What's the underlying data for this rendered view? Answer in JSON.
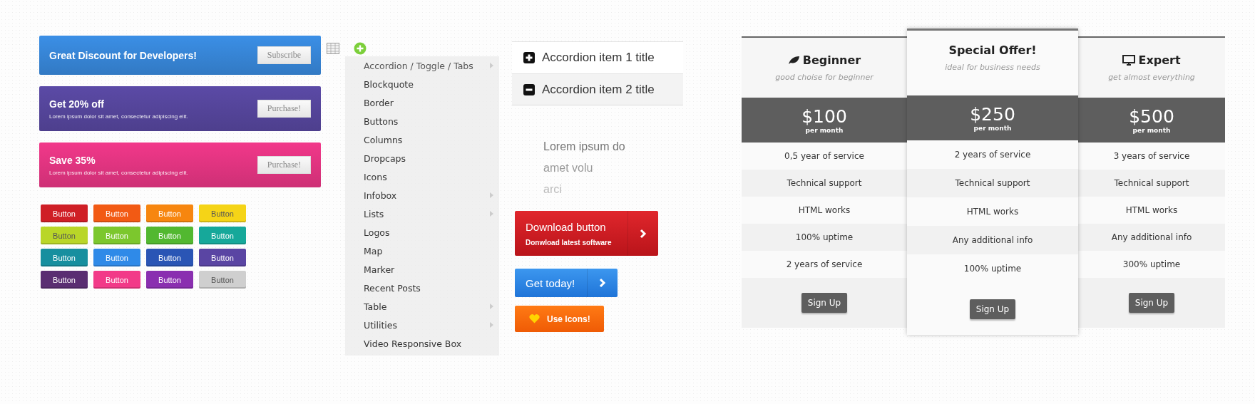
{
  "banners": [
    {
      "title": "Great Discount for Developers!",
      "button": "Subscribe",
      "color": "#3b8fe6"
    },
    {
      "title": "Get 20% off",
      "text": "Lorem ipsum dolor sit amet, consectetur adipiscing elit.",
      "button": "Purchase!",
      "color": "#5b4aa6"
    },
    {
      "title": "Save 35%",
      "text": "Lorem ipsum dolor sit amet, consectetur adipiscing elit.",
      "button": "Purchase!",
      "color": "#f2388a"
    }
  ],
  "color_buttons": [
    {
      "label": "Button",
      "color": "#cf1f26"
    },
    {
      "label": "Button",
      "color": "#f25a14"
    },
    {
      "label": "Button",
      "color": "#f7860f"
    },
    {
      "label": "Button",
      "color": "#f5d417"
    },
    {
      "label": "Button",
      "color": "#b9d628"
    },
    {
      "label": "Button",
      "color": "#7cc72d"
    },
    {
      "label": "Button",
      "color": "#52b830"
    },
    {
      "label": "Button",
      "color": "#16a89a"
    },
    {
      "label": "Button",
      "color": "#178f9f"
    },
    {
      "label": "Button",
      "color": "#2f8ae8"
    },
    {
      "label": "Button",
      "color": "#2a55b5"
    },
    {
      "label": "Button",
      "color": "#5a45a3"
    },
    {
      "label": "Button",
      "color": "#5a2e72"
    },
    {
      "label": "Button",
      "color": "#f23a88"
    },
    {
      "label": "Button",
      "color": "#8a2fb0"
    },
    {
      "label": "Button",
      "color": "#cfcfcf"
    }
  ],
  "shortcode_menu": {
    "items": [
      {
        "label": "Accordion / Toggle / Tabs",
        "has_submenu": true
      },
      {
        "label": "Blockquote",
        "has_submenu": false
      },
      {
        "label": "Border",
        "has_submenu": false
      },
      {
        "label": "Buttons",
        "has_submenu": false
      },
      {
        "label": "Columns",
        "has_submenu": false
      },
      {
        "label": "Dropcaps",
        "has_submenu": false
      },
      {
        "label": "Icons",
        "has_submenu": false
      },
      {
        "label": "Infobox",
        "has_submenu": true
      },
      {
        "label": "Lists",
        "has_submenu": true
      },
      {
        "label": "Logos",
        "has_submenu": false
      },
      {
        "label": "Map",
        "has_submenu": false
      },
      {
        "label": "Marker",
        "has_submenu": false
      },
      {
        "label": "Recent Posts",
        "has_submenu": false
      },
      {
        "label": "Table",
        "has_submenu": true
      },
      {
        "label": "Utilities",
        "has_submenu": true
      },
      {
        "label": "Video Responsive Box",
        "has_submenu": false
      }
    ]
  },
  "accordion": [
    {
      "title": "Accordion item 1 title",
      "expanded": false
    },
    {
      "title": "Accordion item 2 title",
      "expanded": true,
      "body_lines": [
        "Lorem ipsum do",
        "amet volu",
        "arci"
      ]
    }
  ],
  "action_buttons": [
    {
      "kind": "download",
      "label": "Download button",
      "sublabel": "Donwload latest software"
    },
    {
      "kind": "arrow",
      "label": "Get today!"
    },
    {
      "kind": "icon",
      "label": "Use Icons!"
    }
  ],
  "pricing": [
    {
      "featured": false,
      "name": "Beginner",
      "subtitle": "good choise for beginner",
      "price": "$100",
      "period": "per month",
      "features": [
        "0,5 year of service",
        "Technical support",
        "HTML works",
        "100% uptime",
        "2 years of service"
      ],
      "button": "Sign Up"
    },
    {
      "featured": true,
      "name": "Special Offer!",
      "subtitle": "ideal for business needs",
      "price": "$250",
      "period": "per month",
      "features": [
        "2 years of service",
        "Technical support",
        "HTML works",
        "Any additional info",
        "100% uptime"
      ],
      "button": "Sign Up"
    },
    {
      "featured": false,
      "name": "Expert",
      "subtitle": "get almost everything",
      "price": "$500",
      "period": "per month",
      "features": [
        "3 years of service",
        "Technical support",
        "HTML works",
        "Any additional info",
        "300% uptime"
      ],
      "button": "Sign Up"
    }
  ]
}
